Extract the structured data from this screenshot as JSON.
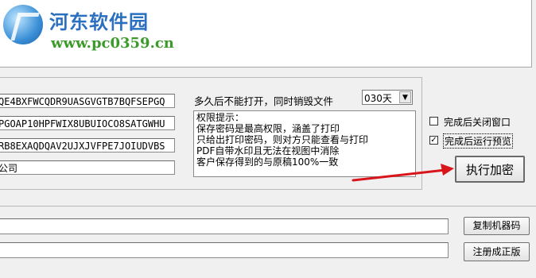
{
  "logo": {
    "name": "河东软件园",
    "url": "www.pc0359.cn"
  },
  "codes": [
    "QE4BXFWCQDR9UASGVGTB7BQFSEPGQ",
    "PGOAP10HPFWIX8UBUIOCO8SATGWHU",
    "RB8EXAQDQAV2UJXJVFPE7JOIUDVBS",
    "公司"
  ],
  "expire": {
    "label": "多久后不能打开，同时销毁文件",
    "value": "030天",
    "arrow_icon": "▼"
  },
  "permissions": {
    "lines": [
      "权限提示：",
      "保存密码是最高权限，涵盖了打印",
      "只给出打印密码，则对方只能查看与打印",
      "PDF自带水印且无法在视图中消除",
      "客户保存得到的与原稿100%一致"
    ]
  },
  "options": {
    "close_after": {
      "label": "完成后关闭窗口",
      "checked": false
    },
    "preview_after": {
      "label": "完成后运行预览",
      "checked": true,
      "check_mark": "✓"
    }
  },
  "buttons": {
    "encrypt": "执行加密",
    "copy_machine_code": "复制机器码",
    "register": "注册成正版"
  },
  "colors": {
    "arrow": "#d9141b",
    "logo_text": "#2a6fc0",
    "logo_url": "#3b9a2a"
  }
}
